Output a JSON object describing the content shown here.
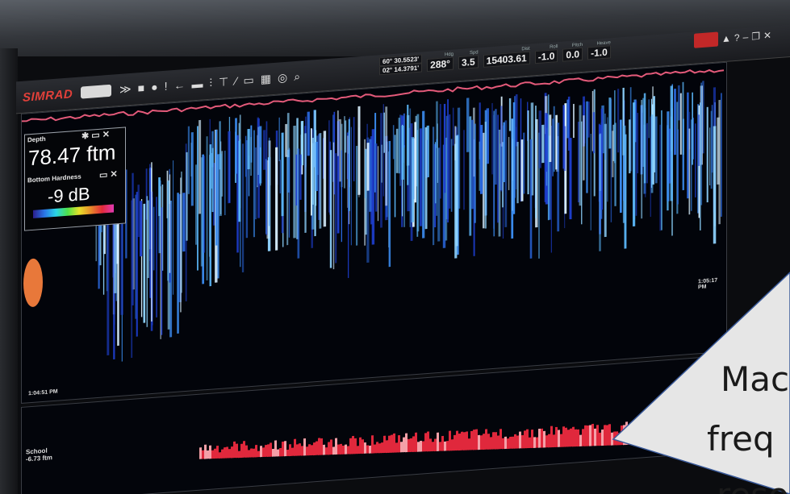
{
  "app": {
    "brand": "SIMRAD"
  },
  "readouts": {
    "latitude": "60° 30.5523'",
    "longitude": "02° 14.3791'",
    "heading_label": "Hdg",
    "heading": "288°",
    "speed_label": "Spd",
    "speed": "3.5",
    "distance_label": "Dist",
    "distance": "15403.61",
    "roll_label": "Roll",
    "roll": "-1.0",
    "pitch_label": "Pitch",
    "pitch": "0.0",
    "heave_label": "Heave",
    "heave": "-1.0"
  },
  "depth_panel": {
    "title": "Depth",
    "value": "78.47 ftm"
  },
  "hardness_panel": {
    "title": "Bottom Hardness",
    "value": "-9 dB"
  },
  "echogram": {
    "time_right": "1:05:17 PM",
    "time_left": "1:04:51 PM"
  },
  "bottom_panel": {
    "label": "School",
    "sub": "-6.73 ftm"
  },
  "callout": {
    "line1": "Mac",
    "line2": "freq",
    "line3": "reso"
  },
  "colors": {
    "brand": "#e2403a",
    "echo_blue": "#2a68e0",
    "bottom_red": "#e0283c",
    "callout_bg": "#e6e6e6",
    "callout_border": "#3a5a9a"
  }
}
